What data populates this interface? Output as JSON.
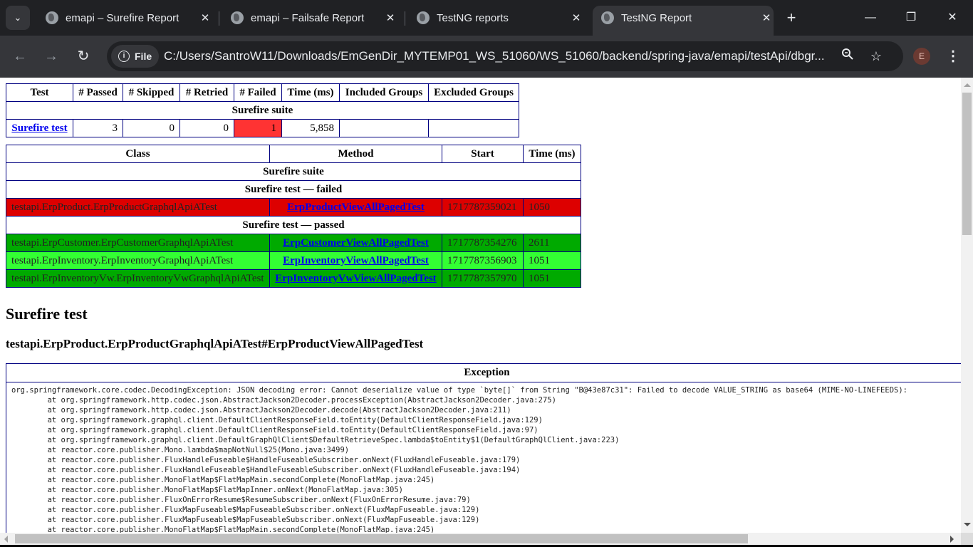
{
  "browser": {
    "tabs": [
      {
        "title": "emapi – Surefire Report",
        "active": false
      },
      {
        "title": "emapi – Failsafe Report",
        "active": false
      },
      {
        "title": "TestNG reports",
        "active": false
      },
      {
        "title": "TestNG Report",
        "active": true
      }
    ],
    "tab_close_glyph": "✕",
    "new_tab_glyph": "+",
    "window_controls": {
      "minimize": "—",
      "restore": "❐",
      "close": "✕"
    },
    "nav": {
      "back": "←",
      "forward": "→",
      "reload": "↻"
    },
    "security_chip": {
      "icon": "i",
      "label": "File"
    },
    "url": "C:/Users/SantroW11/Downloads/EmGenDir_MYTEMP01_WS_51060/WS_51060/backend/spring-java/emapi/testApi/dbgr...",
    "zoom_icon": "🔍",
    "bookmark_icon": "☆",
    "profile_initial": "E",
    "menu_glyph": "⋮"
  },
  "summary_table": {
    "headers": [
      "Test",
      "# Passed",
      "# Skipped",
      "# Retried",
      "# Failed",
      "Time (ms)",
      "Included Groups",
      "Excluded Groups"
    ],
    "suite_name": "Surefire suite",
    "rows": [
      {
        "test": "Surefire test",
        "passed": "3",
        "skipped": "0",
        "retried": "0",
        "failed": "1",
        "time": "5,858",
        "included": "",
        "excluded": ""
      }
    ]
  },
  "methods_table": {
    "headers": [
      "Class",
      "Method",
      "Start",
      "Time (ms)"
    ],
    "suite_name": "Surefire suite",
    "failed_label": "Surefire test — failed",
    "passed_label": "Surefire test — passed",
    "failed_rows": [
      {
        "class": "testapi.ErpProduct.ErpProductGraphqlApiATest",
        "method": "ErpProductViewAllPagedTest",
        "start": "1717787359021",
        "time": "1050"
      }
    ],
    "passed_rows": [
      {
        "class": "testapi.ErpCustomer.ErpCustomerGraphqlApiATest",
        "method": "ErpCustomerViewAllPagedTest",
        "start": "1717787354276",
        "time": "2611"
      },
      {
        "class": "testapi.ErpInventory.ErpInventoryGraphqlApiATest",
        "method": "ErpInventoryViewAllPagedTest",
        "start": "1717787356903",
        "time": "1051"
      },
      {
        "class": "testapi.ErpInventoryVw.ErpInventoryVwGraphqlApiATest",
        "method": "ErpInventoryVwViewAllPagedTest",
        "start": "1717787357970",
        "time": "1051"
      }
    ]
  },
  "detail": {
    "test_heading": "Surefire test",
    "method_heading": "testapi.ErpProduct.ErpProductGraphqlApiATest#ErpProductViewAllPagedTest",
    "exception_header": "Exception",
    "stack_trace": "org.springframework.core.codec.DecodingException: JSON decoding error: Cannot deserialize value of type `byte[]` from String \"B@43e87c31\": Failed to decode VALUE_STRING as base64 (MIME-NO-LINEFEEDS):\n\tat org.springframework.http.codec.json.AbstractJackson2Decoder.processException(AbstractJackson2Decoder.java:275)\n\tat org.springframework.http.codec.json.AbstractJackson2Decoder.decode(AbstractJackson2Decoder.java:211)\n\tat org.springframework.graphql.client.DefaultClientResponseField.toEntity(DefaultClientResponseField.java:129)\n\tat org.springframework.graphql.client.DefaultClientResponseField.toEntity(DefaultClientResponseField.java:97)\n\tat org.springframework.graphql.client.DefaultGraphQlClient$DefaultRetrieveSpec.lambda$toEntity$1(DefaultGraphQlClient.java:223)\n\tat reactor.core.publisher.Mono.lambda$mapNotNull$25(Mono.java:3499)\n\tat reactor.core.publisher.FluxHandleFuseable$HandleFuseableSubscriber.onNext(FluxHandleFuseable.java:179)\n\tat reactor.core.publisher.FluxHandleFuseable$HandleFuseableSubscriber.onNext(FluxHandleFuseable.java:194)\n\tat reactor.core.publisher.MonoFlatMap$FlatMapMain.secondComplete(MonoFlatMap.java:245)\n\tat reactor.core.publisher.MonoFlatMap$FlatMapInner.onNext(MonoFlatMap.java:305)\n\tat reactor.core.publisher.FluxOnErrorResume$ResumeSubscriber.onNext(FluxOnErrorResume.java:79)\n\tat reactor.core.publisher.FluxMapFuseable$MapFuseableSubscriber.onNext(FluxMapFuseable.java:129)\n\tat reactor.core.publisher.FluxMapFuseable$MapFuseableSubscriber.onNext(FluxMapFuseable.java:129)\n\tat reactor.core.publisher.MonoFlatMap$FlatMapMain.secondComplete(MonoFlatMap.java:245)"
  },
  "colors": {
    "failed_row": "#dd0000",
    "failed_count": "#ff3333",
    "passed_row_dark": "#00aa00",
    "passed_row_light": "#33ff33",
    "table_border": "#000080",
    "link": "#0000ee"
  }
}
